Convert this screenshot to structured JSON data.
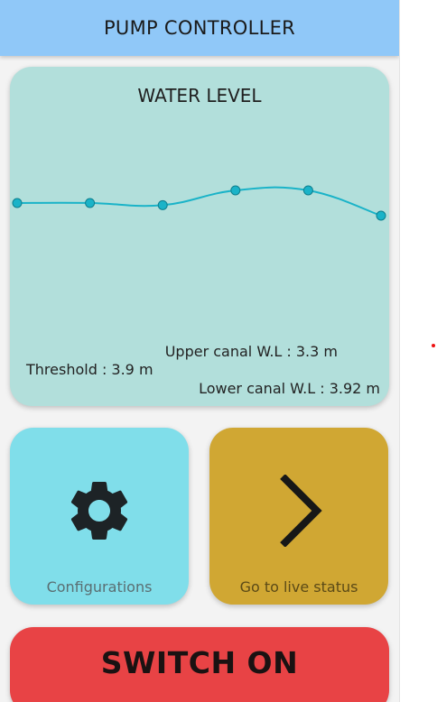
{
  "header": {
    "title": "PUMP CONTROLLER"
  },
  "water_level": {
    "title": "WATER LEVEL",
    "chart_data": {
      "type": "line",
      "x": [
        0,
        1,
        2,
        3,
        4,
        5
      ],
      "values": [
        3.6,
        3.6,
        3.58,
        3.72,
        3.72,
        3.48
      ],
      "title": "WATER LEVEL",
      "xlabel": "",
      "ylabel": "",
      "grid": false,
      "color": "#1ab3c8"
    },
    "threshold": "Threshold : 3.9 m",
    "upper_canal": "Upper canal W.L : 3.3 m",
    "lower_canal": "Lower canal W.L : 3.92 m"
  },
  "tiles": {
    "configurations": {
      "label": "Configurations",
      "icon": "gear-icon",
      "color": "#80deea"
    },
    "live_status": {
      "label": "Go to live status",
      "icon": "chevron-right-icon",
      "color": "#d0a733"
    }
  },
  "switch": {
    "label": "SWITCH ON",
    "color": "#e84345"
  },
  "colors": {
    "header": "#90c8f8",
    "water_card": "#b2dfdb",
    "line": "#1ab3c8"
  }
}
